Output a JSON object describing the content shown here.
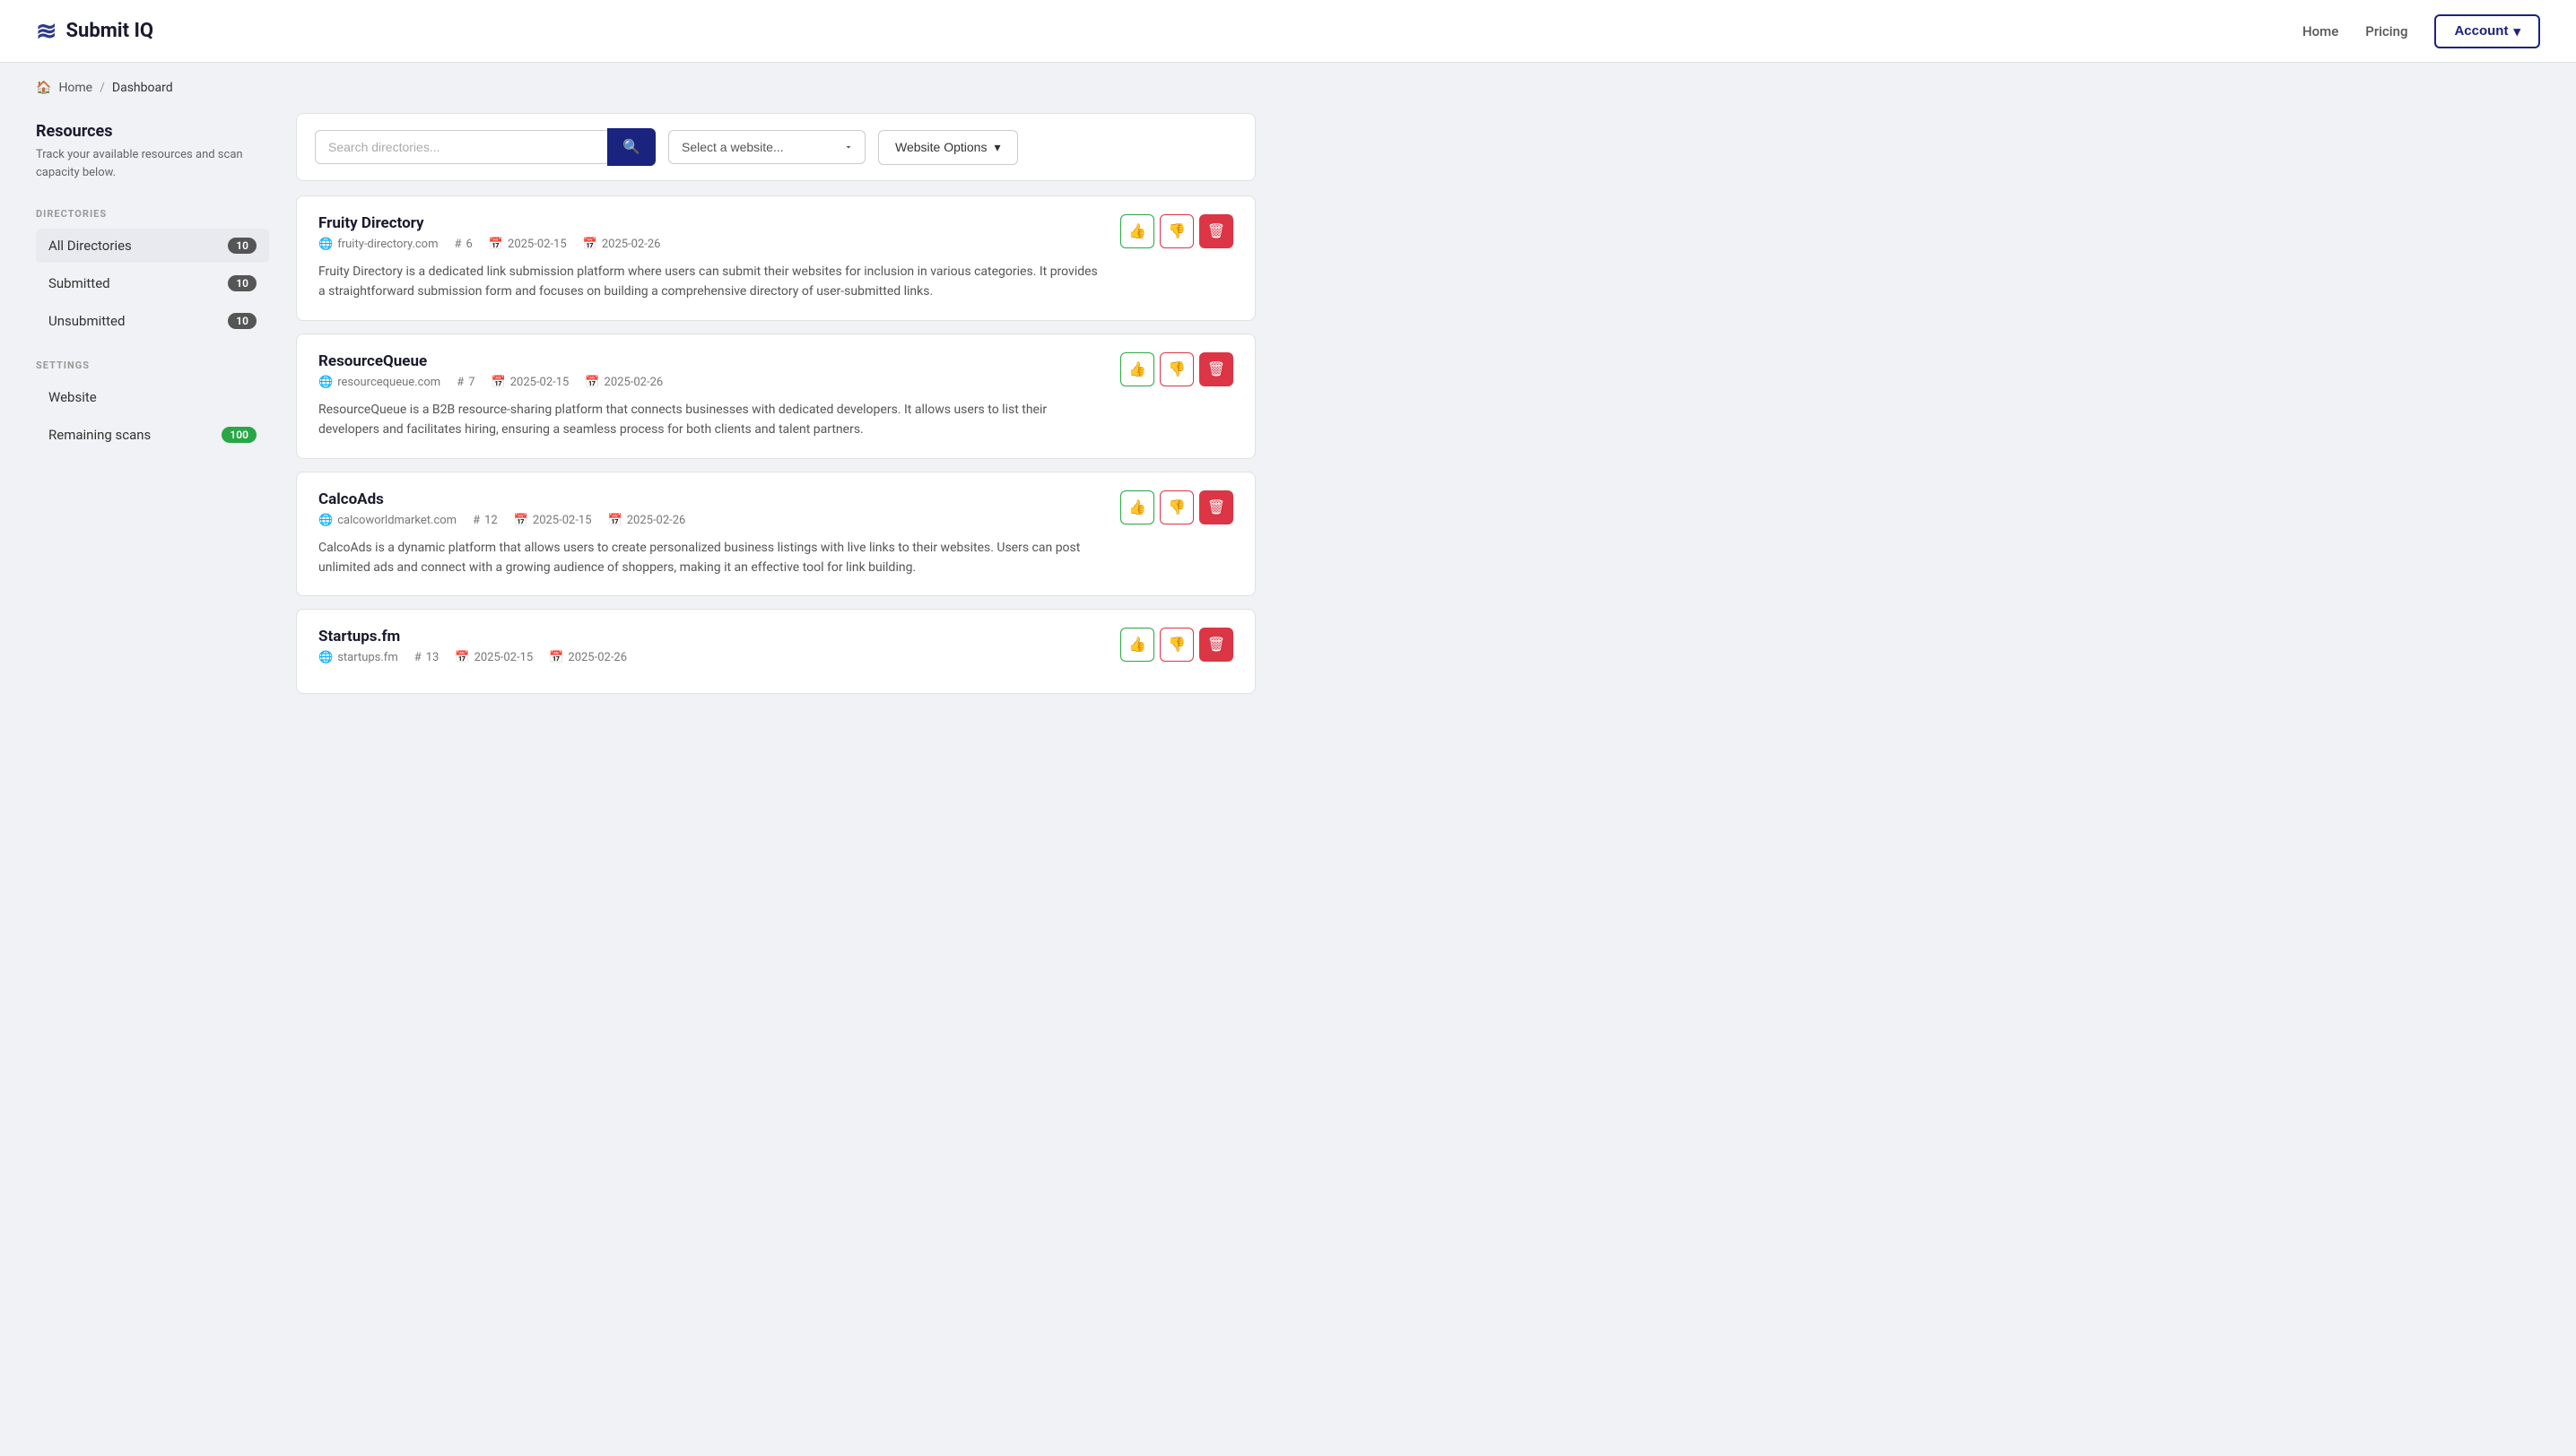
{
  "app": {
    "name": "Submit IQ",
    "logo_icon": "≡"
  },
  "navbar": {
    "links": [
      {
        "label": "Home",
        "href": "#"
      },
      {
        "label": "Pricing",
        "href": "#"
      }
    ],
    "account_label": "Account",
    "account_chevron": "▾"
  },
  "breadcrumb": {
    "home": "Home",
    "separator": "/",
    "current": "Dashboard"
  },
  "sidebar": {
    "resources_title": "Resources",
    "resources_desc": "Track your available resources and scan capacity below.",
    "directories_section": "DIRECTORIES",
    "items": [
      {
        "label": "All Directories",
        "badge": "10",
        "badge_type": "dark"
      },
      {
        "label": "Submitted",
        "badge": "10",
        "badge_type": "dark"
      },
      {
        "label": "Unsubmitted",
        "badge": "10",
        "badge_type": "dark"
      }
    ],
    "settings_section": "SETTINGS",
    "settings_items": [
      {
        "label": "Website",
        "badge": null
      },
      {
        "label": "Remaining scans",
        "badge": "100",
        "badge_type": "green"
      }
    ]
  },
  "toolbar": {
    "search_placeholder": "Search directories...",
    "search_icon": "🔍",
    "website_select_placeholder": "Select a website...",
    "website_options_label": "Website Options",
    "chevron": "▾"
  },
  "directories": [
    {
      "title": "Fruity Directory",
      "domain": "fruity-directory.com",
      "number": "6",
      "date1": "2025-02-15",
      "date2": "2025-02-26",
      "description": "Fruity Directory is a dedicated link submission platform where users can submit their websites for inclusion in various categories. It provides a straightforward submission form and focuses on building a comprehensive directory of user-submitted links."
    },
    {
      "title": "ResourceQueue",
      "domain": "resourcequeue.com",
      "number": "7",
      "date1": "2025-02-15",
      "date2": "2025-02-26",
      "description": "ResourceQueue is a B2B resource-sharing platform that connects businesses with dedicated developers. It allows users to list their developers and facilitates hiring, ensuring a seamless process for both clients and talent partners."
    },
    {
      "title": "CalcoAds",
      "domain": "calcoworldmarket.com",
      "number": "12",
      "date1": "2025-02-15",
      "date2": "2025-02-26",
      "description": "CalcoAds is a dynamic platform that allows users to create personalized business listings with live links to their websites. Users can post unlimited ads and connect with a growing audience of shoppers, making it an effective tool for link building."
    },
    {
      "title": "Startups.fm",
      "domain": "startups.fm",
      "number": "13",
      "date1": "2025-02-15",
      "date2": "2025-02-26",
      "description": ""
    }
  ],
  "actions": {
    "approve": "👍",
    "reject": "👎",
    "delete": "🗑"
  }
}
